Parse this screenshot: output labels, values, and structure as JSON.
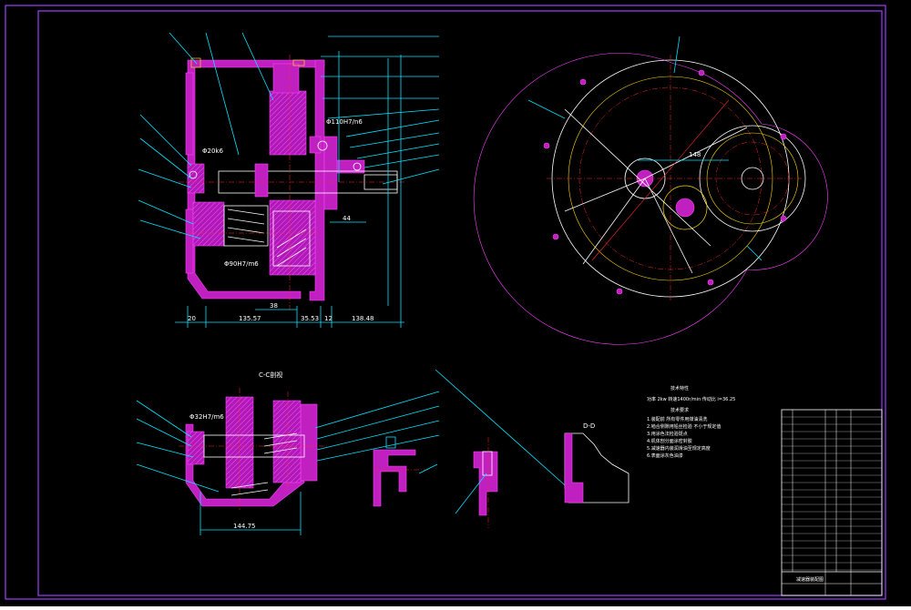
{
  "dimensions": {
    "d_20": "20",
    "d_135_57": "135.57",
    "d_38": "38",
    "d_35_53": "35.53",
    "d_12": "12",
    "d_138_48": "138.48",
    "d_148": "148",
    "d_144_75": "144.75",
    "d_44": "44"
  },
  "fits": {
    "fit_20k6": "Φ20k6",
    "fit_110h7": "Φ110H7/n6",
    "fit_32h7": "Φ32H7/m6",
    "fit_90h7": "Φ90H7/m6"
  },
  "views": {
    "section_cc": "C-C剖视",
    "section_dd": "D-D"
  },
  "tech_requirements": {
    "perf_title": "技术特性",
    "perf_line": "功率 2kw 转速1400r/min 传动比 i=36.25",
    "req_title": "技术要求",
    "req_lines": [
      "1.装配前 所有零件用煤油清洗",
      "2.啮合侧隙用铅丝检验 不小于规定值",
      "3.用涂色法检验斑点",
      "4.机体剖分面涂密封胶",
      "5.减速器内装润滑油至规定高度",
      "6.表面涂灰色油漆"
    ]
  },
  "title_block": {
    "drawing_name": "减速器装配图"
  }
}
